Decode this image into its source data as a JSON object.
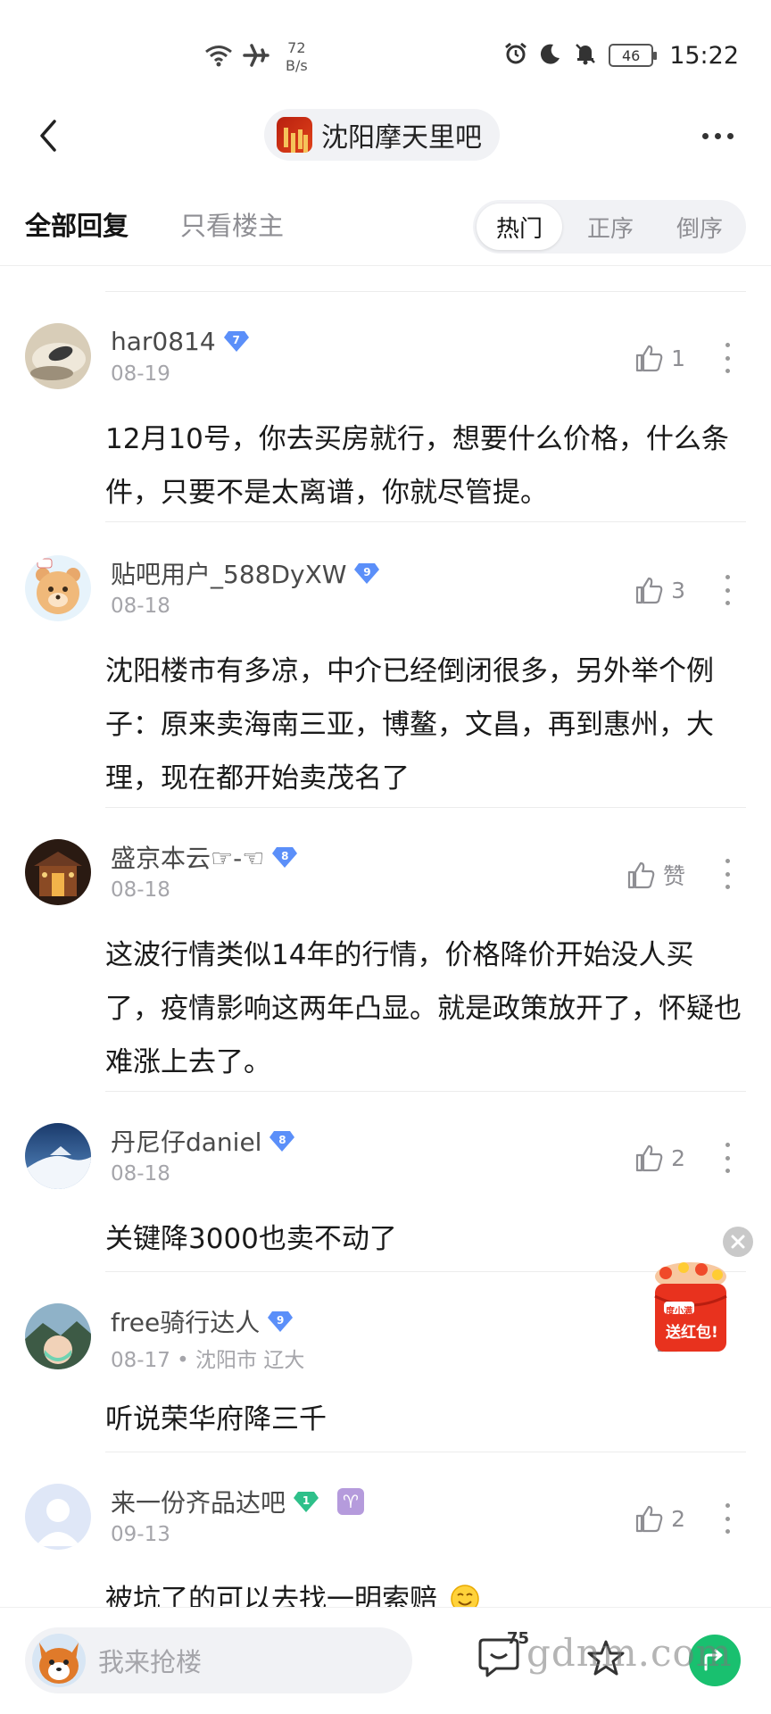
{
  "status_bar": {
    "speed_value": "72",
    "speed_unit": "B/s",
    "battery": "46",
    "time": "15:22"
  },
  "header": {
    "forum_name": "沈阳摩天里吧"
  },
  "tabs": {
    "all": "全部回复",
    "owner_only": "只看楼主"
  },
  "sort": {
    "hot": "热门",
    "asc": "正序",
    "desc": "倒序"
  },
  "posts": [
    {
      "username": "har0814",
      "level": "7",
      "meta": "08-19",
      "likes": "1",
      "content": "12月10号，你去买房就行，想要什么价格，什么条件，只要不是太离谱，你就尽管提。"
    },
    {
      "username": "贴吧用户_588DyXW",
      "level": "9",
      "meta": "08-18",
      "likes": "3",
      "content": "沈阳楼市有多凉，中介已经倒闭很多，另外举个例子：原来卖海南三亚，博鳌，文昌，再到惠州，大理，现在都开始卖茂名了"
    },
    {
      "username": "盛京本云☞-☜",
      "level": "8",
      "meta": "08-18",
      "likes": "赞",
      "content": "这波行情类似14年的行情，价格降价开始没人买了，疫情影响这两年凸显。就是政策放开了，怀疑也难涨上去了。"
    },
    {
      "username": "丹尼仔daniel",
      "level": "8",
      "meta": "08-18",
      "likes": "2",
      "content": "关键降3000也卖不动了"
    },
    {
      "username": "free骑行达人",
      "level": "9",
      "meta": "08-17",
      "location": "沈阳市 辽大",
      "content": "听说荣华府降三千"
    },
    {
      "username": "来一份齐品达吧",
      "level": "1",
      "zodiac": "♈",
      "meta": "09-13",
      "likes": "2",
      "content": "被坑了的可以去找一明索赔"
    }
  ],
  "float_ad": {
    "brand": "度小满",
    "label": "送红包!"
  },
  "bottom": {
    "placeholder": "我来抢楼",
    "comment_count": "75",
    "watermark": "gdnm.com"
  },
  "colors": {
    "level_badge": "#5b8ff9",
    "level_badge_green": "#2ec08a",
    "share_green": "#19c06f",
    "ad_red": "#e8321e"
  }
}
